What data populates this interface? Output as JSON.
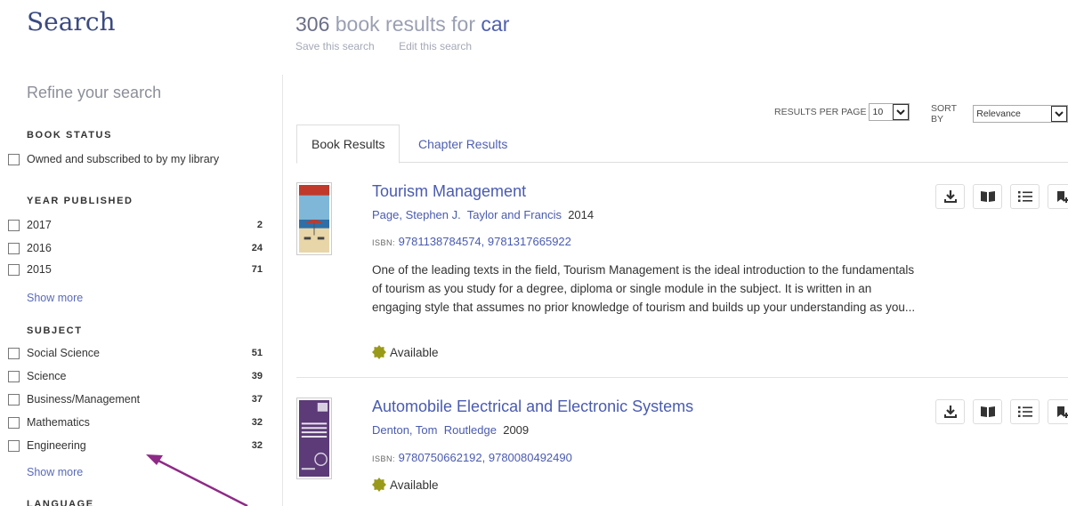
{
  "page": {
    "title": "Search"
  },
  "results_header": {
    "count": "306",
    "text": "book results for",
    "query": "car",
    "save_search": "Save this search",
    "edit_search": "Edit this search"
  },
  "sidebar": {
    "refine_title": "Refine your search",
    "book_status": {
      "heading": "BOOK STATUS",
      "items": [
        {
          "label": "Owned and subscribed to by my library"
        }
      ]
    },
    "year_published": {
      "heading": "YEAR PUBLISHED",
      "items": [
        {
          "label": "2017",
          "count": "2"
        },
        {
          "label": "2016",
          "count": "24"
        },
        {
          "label": "2015",
          "count": "71"
        }
      ],
      "show_more": "Show more"
    },
    "subject": {
      "heading": "SUBJECT",
      "items": [
        {
          "label": "Social Science",
          "count": "51"
        },
        {
          "label": "Science",
          "count": "39"
        },
        {
          "label": "Business/Management",
          "count": "37"
        },
        {
          "label": "Mathematics",
          "count": "32"
        },
        {
          "label": "Engineering",
          "count": "32"
        }
      ],
      "show_more": "Show more"
    },
    "language": {
      "heading": "LANGUAGE"
    }
  },
  "controls": {
    "results_per_page_label": "RESULTS PER PAGE",
    "results_per_page_value": "10",
    "sort_by_label": "SORT BY",
    "sort_by_value": "Relevance"
  },
  "tabs": [
    {
      "label": "Book Results",
      "active": true
    },
    {
      "label": "Chapter Results",
      "active": false
    }
  ],
  "results": [
    {
      "title": "Tourism Management",
      "authors": "Page, Stephen J.",
      "publisher": "Taylor and Francis",
      "year": "2014",
      "isbn_label": "ISBN:",
      "isbn": "9781138784574, 9781317665922",
      "description": "One of the leading texts in the field, Tourism Management is the ideal introduction to the fundamentals of tourism as you study for a degree, diploma or single module in the subject. It is written in an engaging style that assumes no prior knowledge of tourism and builds up your understanding as you...",
      "availability": "Available"
    },
    {
      "title": "Automobile Electrical and Electronic Systems",
      "authors": "Denton, Tom",
      "publisher": "Routledge",
      "year": "2009",
      "isbn_label": "ISBN:",
      "isbn": "9780750662192, 9780080492490",
      "availability": "Available",
      "cover_text": "AUTOMOBILE ELECTRICAL AND ELECTRONIC SYSTEMS"
    }
  ],
  "colors": {
    "link": "#4a5bb0",
    "available": "#9a9a1a",
    "annotation": "#8e2a86"
  },
  "icons": [
    "download-icon",
    "read-book-icon",
    "list-icon",
    "add-to-list-icon",
    "checkbox-icon",
    "chevron-down-icon",
    "available-badge-icon",
    "annotation-arrow-icon"
  ]
}
